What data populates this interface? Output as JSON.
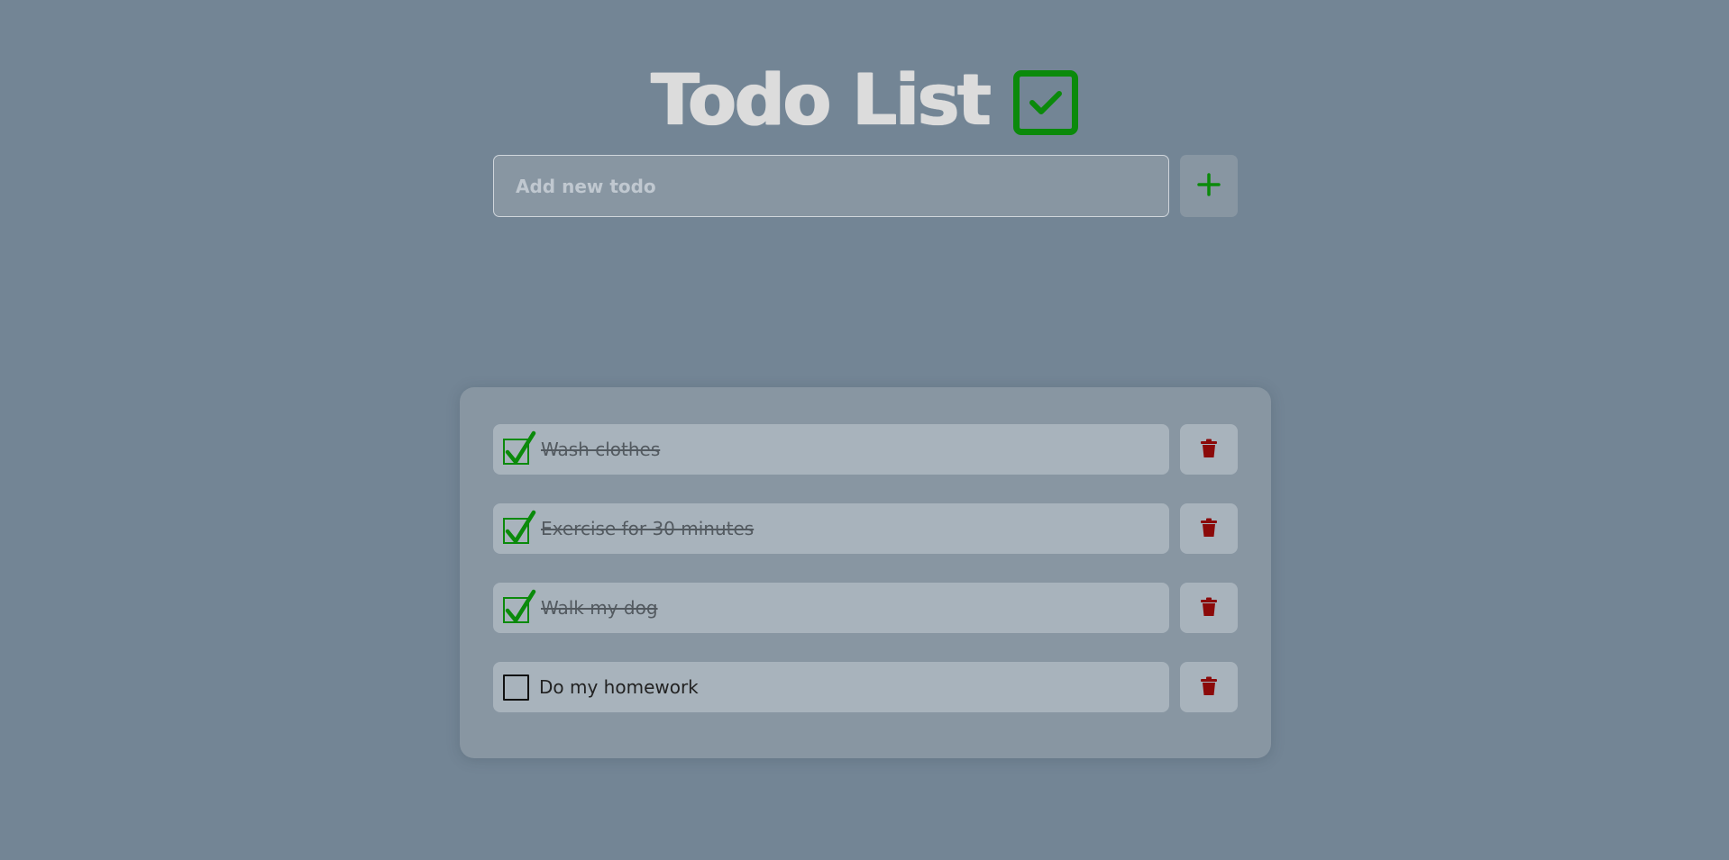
{
  "header": {
    "title": "Todo List",
    "icon": "check-square-icon"
  },
  "add_form": {
    "placeholder": "Add new todo",
    "value": "",
    "add_icon": "plus-icon"
  },
  "todos": [
    {
      "text": "Wash clothes",
      "done": true
    },
    {
      "text": "Exercise for 30 minutes",
      "done": true
    },
    {
      "text": "Walk my dog",
      "done": true
    },
    {
      "text": "Do my homework",
      "done": false
    }
  ],
  "colors": {
    "background": "#738595",
    "accent_green": "#0b8a0b",
    "delete_red": "#8b0a0a",
    "card": "#8896a2",
    "item": "#a8b3bc"
  }
}
